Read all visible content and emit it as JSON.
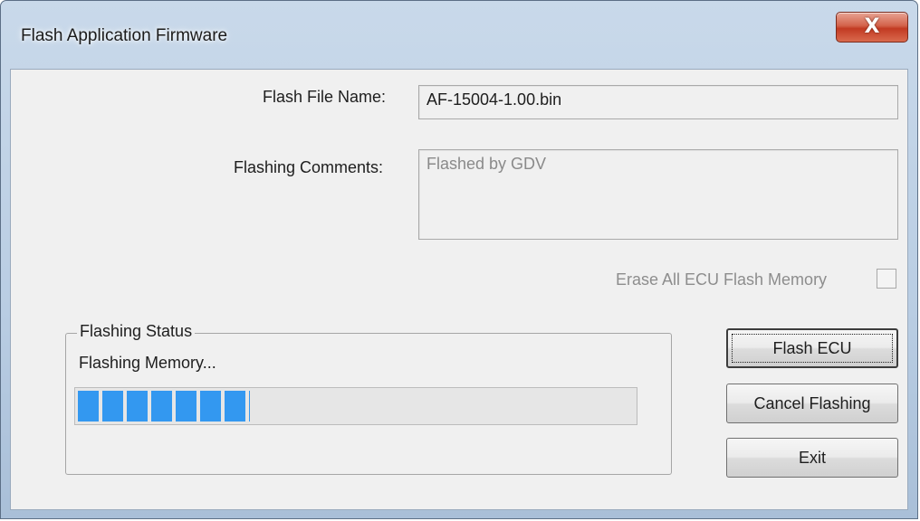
{
  "window": {
    "title": "Flash Application Firmware",
    "close_glyph": "X"
  },
  "form": {
    "file_name_label": "Flash File Name:",
    "file_name_value": "AF-15004-1.00.bin",
    "comments_label": "Flashing Comments:",
    "comments_value": "Flashed by GDV",
    "erase_label": "Erase All ECU Flash Memory",
    "erase_checked": false
  },
  "status": {
    "group_title": "Flashing Status",
    "message": "Flashing Memory...",
    "progress_fraction": 0.31,
    "progress_color": "#3398f0"
  },
  "buttons": {
    "flash": "Flash ECU",
    "cancel": "Cancel Flashing",
    "exit": "Exit"
  }
}
